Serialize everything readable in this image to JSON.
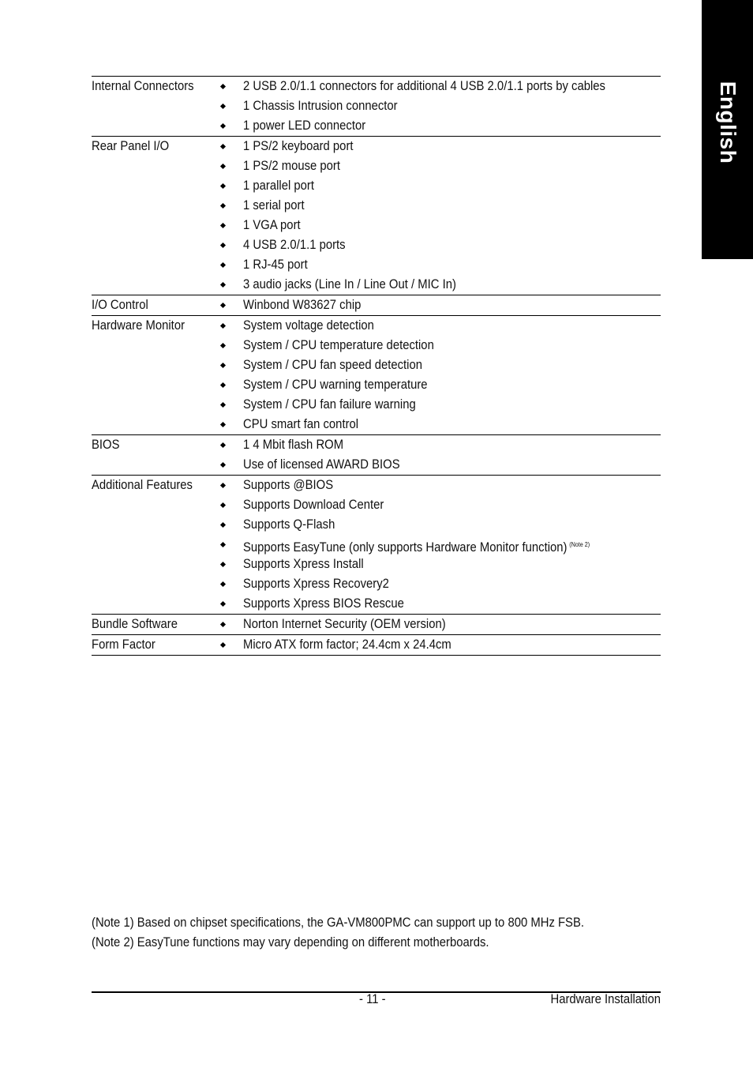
{
  "side_tab": {
    "label": "English"
  },
  "spec_groups": [
    {
      "label": "Internal Connectors",
      "items": [
        {
          "text": "2 USB 2.0/1.1 connectors for additional 4 USB 2.0/1.1 ports by cables"
        },
        {
          "text": "1 Chassis Intrusion connector"
        },
        {
          "text": "1 power LED connector"
        }
      ]
    },
    {
      "label": "Rear Panel I/O",
      "items": [
        {
          "text": "1 PS/2 keyboard port"
        },
        {
          "text": "1 PS/2 mouse port"
        },
        {
          "text": "1 parallel port"
        },
        {
          "text": "1 serial port"
        },
        {
          "text": "1 VGA port"
        },
        {
          "text": "4 USB 2.0/1.1 ports"
        },
        {
          "text": "1 RJ-45 port"
        },
        {
          "text": "3 audio jacks (Line In / Line Out / MIC In)"
        }
      ]
    },
    {
      "label": "I/O Control",
      "items": [
        {
          "text": "Winbond W83627 chip"
        }
      ]
    },
    {
      "label": "Hardware Monitor",
      "items": [
        {
          "text": "System voltage detection"
        },
        {
          "text": "System / CPU temperature detection"
        },
        {
          "text": "System / CPU fan speed detection"
        },
        {
          "text": "System / CPU warning temperature"
        },
        {
          "text": "System / CPU fan failure warning"
        },
        {
          "text": "CPU smart fan control"
        }
      ]
    },
    {
      "label": "BIOS",
      "items": [
        {
          "text": "1 4 Mbit flash ROM"
        },
        {
          "text": "Use of licensed AWARD BIOS"
        }
      ]
    },
    {
      "label": "Additional Features",
      "items": [
        {
          "text": "Supports @BIOS"
        },
        {
          "text": "Supports Download Center"
        },
        {
          "text": "Supports Q-Flash"
        },
        {
          "text": "Supports EasyTune (only supports Hardware Monitor function)",
          "note": "(Note 2)"
        },
        {
          "text": "Supports Xpress Install"
        },
        {
          "text": "Supports Xpress Recovery2"
        },
        {
          "text": "Supports Xpress BIOS Rescue"
        }
      ]
    },
    {
      "label": "Bundle Software",
      "items": [
        {
          "text": "Norton Internet Security (OEM version)"
        }
      ]
    },
    {
      "label": "Form Factor",
      "items": [
        {
          "text": "Micro ATX form factor; 24.4cm x 24.4cm"
        }
      ]
    }
  ],
  "notes": [
    "(Note 1) Based on chipset specifications, the GA-VM800PMC can support up to 800 MHz FSB.",
    "(Note 2) EasyTune functions may vary depending on different motherboards."
  ],
  "footer": {
    "page_number": "- 11 -",
    "section": "Hardware Installation"
  }
}
